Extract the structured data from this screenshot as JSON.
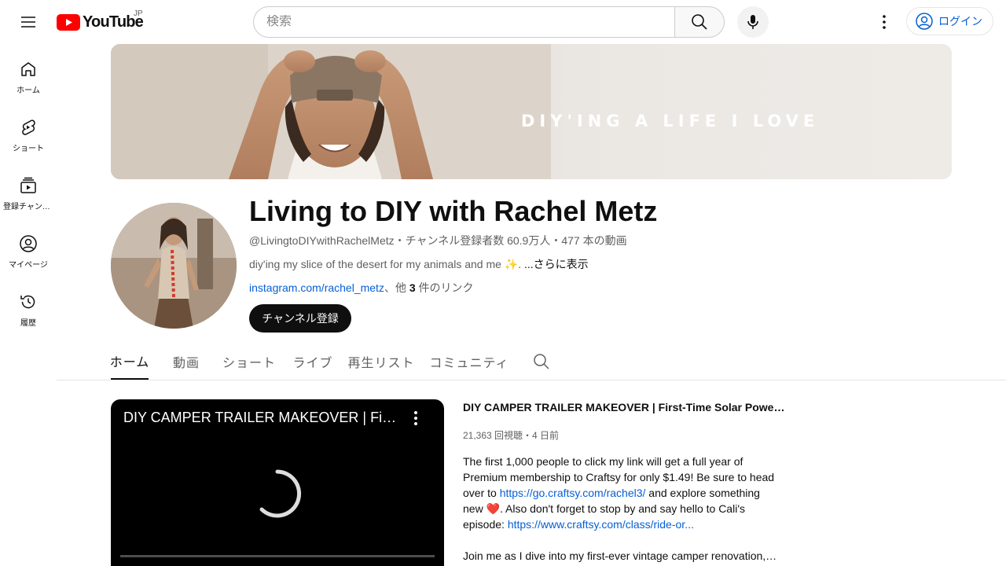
{
  "header": {
    "logo_text": "YouTube",
    "region": "JP",
    "search_placeholder": "検索",
    "login_label": "ログイン"
  },
  "sidebar": {
    "items": [
      {
        "label": "ホーム",
        "icon": "home-icon"
      },
      {
        "label": "ショート",
        "icon": "shorts-icon"
      },
      {
        "label": "登録チャンネル",
        "icon": "subscriptions-icon"
      },
      {
        "label": "マイページ",
        "icon": "you-icon"
      },
      {
        "label": "履歴",
        "icon": "history-icon"
      }
    ]
  },
  "banner": {
    "text": "DIY'ING A LIFE I LOVE"
  },
  "channel": {
    "title": "Living to DIY with Rachel Metz",
    "handle": "@LivingtoDIYwithRachelMetz",
    "subscribers": "チャンネル登録者数 60.9万人",
    "videos": "477 本の動画",
    "separator": "・",
    "description": "diy'ing my slice of the desert for my animals and me ✨.",
    "more_label": "...さらに表示",
    "link": "instagram.com/rachel_metz",
    "others_prefix": "、他 ",
    "others_count": "3",
    "others_suffix": " 件のリンク",
    "subscribe_label": "チャンネル登録"
  },
  "tabs": [
    {
      "label": "ホーム",
      "active": true
    },
    {
      "label": "動画",
      "active": false
    },
    {
      "label": "ショート",
      "active": false
    },
    {
      "label": "ライブ",
      "active": false
    },
    {
      "label": "再生リスト",
      "active": false
    },
    {
      "label": "コミュニティ",
      "active": false
    }
  ],
  "featured": {
    "player_title": "DIY CAMPER TRAILER MAKEOVER | First-Time Solar Power Of...",
    "title": "DIY CAMPER TRAILER MAKEOVER | First-Time Solar Power Of...",
    "meta": "21,363 回視聴・4 日前",
    "desc_part1": "The first 1,000 people to click my link will get a full year of Premium membership to Craftsy for only $1.49! Be sure to head over to ",
    "link1": "https://go.craftsy.com/rachel3/",
    "desc_part2": " and explore something new ",
    "heart": "❤️",
    "desc_part3": ". Also don't forget to stop by and say hello to Cali's episode: ",
    "link2": "https://www.craftsy.com/class/ride-or...",
    "desc2": "Join me as I dive into my first-ever vintage camper renovation, ..."
  },
  "colors": {
    "brand_red": "#ff0000",
    "link_blue": "#065fd4",
    "text_secondary": "#606060"
  }
}
